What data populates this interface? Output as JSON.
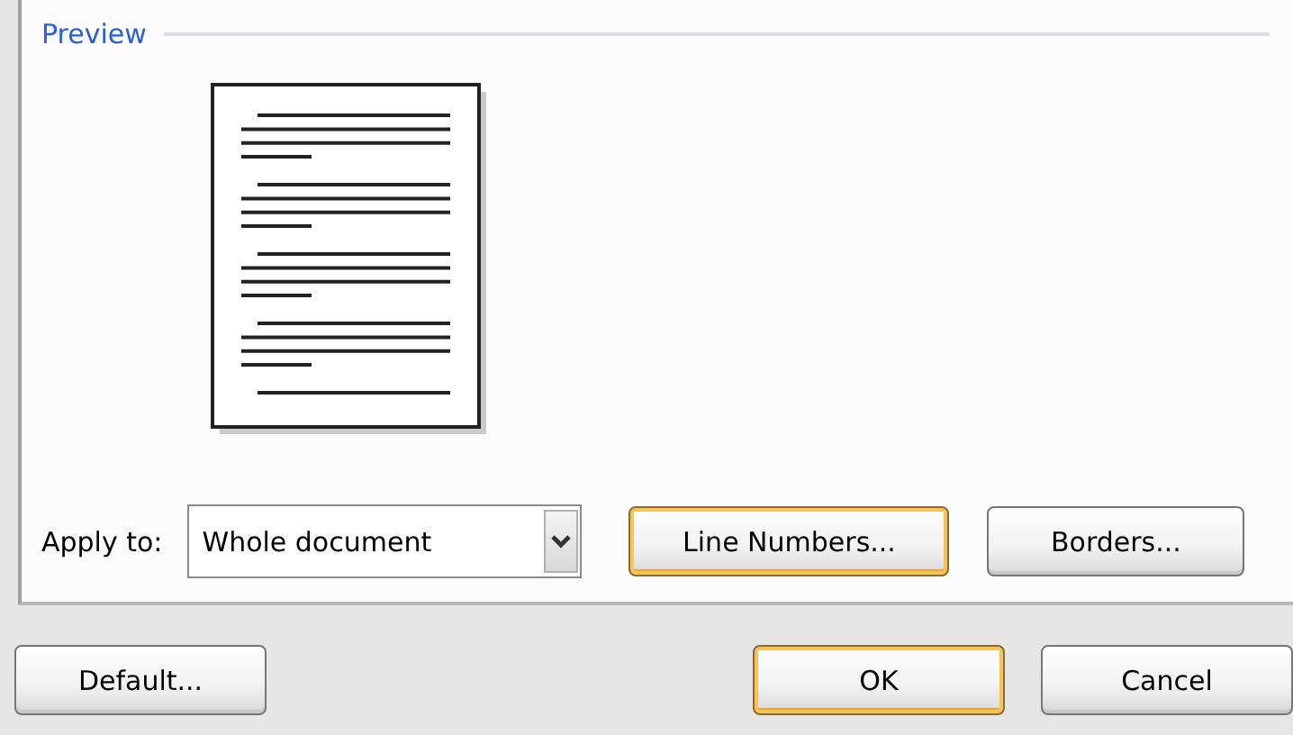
{
  "preview": {
    "legend": "Preview"
  },
  "apply_to": {
    "label": "Apply to:",
    "value": "Whole document"
  },
  "panel_buttons": [
    {
      "label": "Line Numbers...",
      "focused": true
    },
    {
      "label": "Borders...",
      "focused": false
    }
  ],
  "dialog_buttons": [
    {
      "label": "Default...",
      "focused": false
    },
    {
      "label": "OK",
      "focused": true
    },
    {
      "label": "Cancel",
      "focused": false
    }
  ]
}
